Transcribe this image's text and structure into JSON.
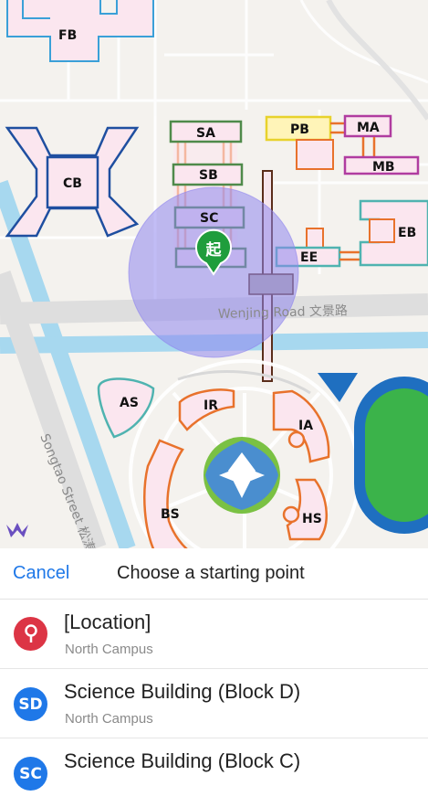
{
  "map": {
    "start_marker_glyph": "起",
    "road_label": "Wenjing Road 文景路",
    "street_label": "Songtao Street 松涛",
    "buildings": [
      "FB",
      "CB",
      "SA",
      "SB",
      "SC",
      "PB",
      "MA",
      "MB",
      "EB",
      "EE",
      "AS",
      "IR",
      "IA",
      "BS",
      "HS"
    ],
    "logo_icon": "crown-logo-icon",
    "colors": {
      "selection_circle": "#8f86ee",
      "marker": "#1f9d3c",
      "water": "#a7d8ef",
      "road": "#dedede",
      "track_field": "#3bb34a",
      "track_ring": "#1f6fc0"
    }
  },
  "panel": {
    "cancel_label": "Cancel",
    "title": "Choose a starting point",
    "items": [
      {
        "icon": "location-pin-icon",
        "color": "#dc3545",
        "name": "[Location]",
        "sub": "North Campus"
      },
      {
        "badge": "SD",
        "color": "#1f78e8",
        "name": "Science Building (Block D)",
        "sub": "North Campus"
      },
      {
        "badge": "SC",
        "color": "#1f78e8",
        "name": "Science Building (Block C)",
        "sub": ""
      }
    ]
  }
}
